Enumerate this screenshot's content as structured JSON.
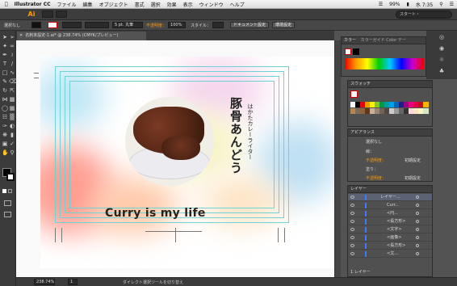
{
  "menubar": {
    "app_name": "Illustrator CC",
    "items": [
      "ファイル",
      "編集",
      "オブジェクト",
      "書式",
      "選択",
      "効果",
      "表示",
      "ウィンドウ",
      "ヘルプ"
    ],
    "status_text": "99%",
    "clock": "水 7:35"
  },
  "appbar": {
    "logo": "Ai",
    "search_label": "スタート・"
  },
  "controlbar": {
    "selection_label": "選択なし",
    "stroke_weight": "5 pt. 丸筆",
    "opacity_label": "不透明度：",
    "opacity_value": "100%",
    "style_label": "スタイル：",
    "doc_settings_btn": "ドキュメント設定",
    "env_settings_btn": "環境設定"
  },
  "document": {
    "tab_title": "名刺未設定-1.ai* @ 238.74% (CMYK/プレビュー)"
  },
  "artwork": {
    "headline": "Curry is my life",
    "name_vertical": "豚骨あんどう",
    "role_vertical": "はかたカレーライター"
  },
  "statusbar": {
    "zoom": "238.74%",
    "page": "1",
    "tool_hint": "ダイレクト選択ツールを切り替え"
  },
  "panels": {
    "color": {
      "title": "カラー",
      "tabs": "カラーガイド Color テー"
    },
    "swatches": {
      "title": "スウォッチ"
    },
    "appearance": {
      "title": "アピアランス",
      "rows": [
        "選択なし",
        "線：",
        "不透明度：",
        "塗り：",
        "不透明度："
      ],
      "default_label": "初期設定"
    },
    "layers": {
      "title": "レイヤー",
      "rows": [
        "レイヤー...",
        "Curr...",
        "<円...",
        "<長方形>",
        "<文字>",
        "<画像>",
        "<長方形>",
        "<文..."
      ],
      "footer": "1 レイヤー"
    }
  },
  "colors": {
    "accent": "#ff9a00",
    "selection_blue": "#3c7bff",
    "guide": "#6fd3d6",
    "headline_text": "#2a2118"
  }
}
